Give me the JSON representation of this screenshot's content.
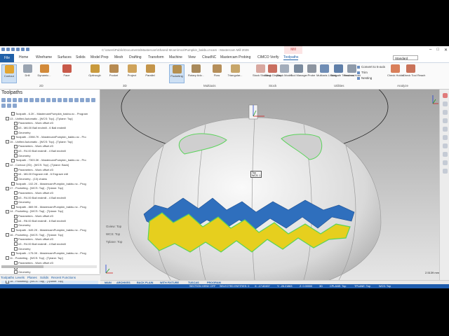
{
  "window": {
    "title": "C:\\Users\\Public\\Documents\\Mastercam\\Shared Mcam\\mcx\\Pumpkin_bakbu.mcam - Mastercam Mill 2026",
    "context_tab": "Mill"
  },
  "tabs": [
    "File",
    "Home",
    "Wireframe",
    "Surfaces",
    "Solids",
    "Model Prep",
    "Mesh",
    "Drafting",
    "Transform",
    "Machine",
    "View",
    "CloudNC",
    "Mastercam Probing",
    "CIMCO Verify",
    "Toolpaths"
  ],
  "tab_active": "Toolpaths",
  "selection_mode": "Standard",
  "ribbon": {
    "buttons": [
      "Contour",
      "Drill",
      "Dynamic...",
      "Face",
      "Optirough",
      "Pocket",
      "Project",
      "Parallel",
      "Pocketing",
      "Rotary Adv...",
      "Flow",
      "Triangular...",
      "Stock Shading",
      "Stock Display",
      "Stock Model",
      "Tool Manager",
      "Probe",
      "Multiaxis Linking",
      "Toolpath Transform",
      "Process Host",
      "Check Holder",
      "Check Tool Reach"
    ],
    "small": [
      "Convert to 5-axis",
      "Trim",
      "Nesting"
    ],
    "groups": [
      "2D",
      "3D",
      "Multiaxis",
      "Stock",
      "Utilities",
      "Analyze"
    ]
  },
  "panel": {
    "title": "Toolpaths",
    "rows": [
      "Toolpath - 6.2K - MastercamPumpkin_bakbu.nc - Program",
      "13 - Unified Automatic - [WCS: Top] - [Tplane: Top]",
      "Parameters - Work offset #3",
      "#3 - M6.00 Ball endmill - 6 Ball endmill",
      "Geometry",
      "Toolpath - 2398.7K - MastercamPumpkin_bakbu.nc - Pro",
      "15 - Unified Automatic - [WCS: Top] - [Tplane: Top]",
      "Parameters - Work offset #3",
      "#3 - R4.00 Ball endmill - 4 Ball endmill",
      "Geometry",
      "Toolpath - 7303.3K - MastercamPumpkin_bakbu.nc - Pro",
      "12 - Contour (2D) - [WCS: Top] - [Tplane: Back]",
      "Parameters - Work offset #3",
      "#4 - M6.00 Engrave mill - 6 Engrave mill",
      "Geometry - (13) chains",
      "Toolpath - 102.2K - MastercamPumpkin_bakbu.nc - Prog",
      "17 - Pocketing - [WCS: Top] - [Tplane: Top]",
      "Parameters - Work offset #3",
      "#3 - R4.00 Ball endmill - 4 Ball endmill",
      "Geometry",
      "Toolpath - 869.9K - MastercamPumpkin_bakbu.nc - Prog",
      "14 - Pocketing - [WCS: Top] - [Tplane: Top]",
      "Parameters - Work offset #3",
      "#4 - R6.00 Ball endmill - 6 Ball endmill",
      "Geometry",
      "Toolpath - 649.2K - MastercamPumpkin_bakbu.nc - Prog",
      "16 - Pocketing - [WCS: Top] - [Tplane: Top]",
      "Parameters - Work offset #3",
      "#3 - R4.00 Ball endmill - 4 Ball endmill",
      "Geometry",
      "Toolpath - 175.0K - MastercamPumpkin_bakbu.nc - Prog",
      "11 - Pocketing - [WCS: Top] - [Tplane: Top]",
      "Parameters - Work offset #3",
      "#3 - R4.00 Ball endmill - 4 Ball endmill",
      "Geometry",
      "Toolpath - 175.0K - MastercamPumpkin_bakbu.nc - Prog",
      "18 - Pocketing - [WCS: Top] - [Tplane: Top]",
      "#5 - R2.00 Ball endmill - 2 Ball endmill",
      "Geometry",
      "Toolpath - 649.2K - MastercamPumpkin_bakbu.nc - Prog"
    ],
    "highlight_index": 36,
    "bottom_tabs": [
      "Toolpaths",
      "Levels",
      "Planes",
      "Solids",
      "Recent Functions"
    ]
  },
  "viewport": {
    "left_labels": [
      "Gview: Top",
      "WCS: Top",
      "Tplane: Top"
    ],
    "tag": [
      "Top",
      "WCS: 1"
    ],
    "scale": "2.5139 mm",
    "view_tabs": [
      "MAIN",
      "ARCHIVES",
      "BACK PLAIN",
      "WITH FIXTURE",
      "TUSCAS",
      "PROGRAM"
    ]
  },
  "status": {
    "items": [
      "SECTION VIEW: OFF",
      "SELECTED ENTITIES: 0",
      "X: -17.82457",
      "Y: -28.21863",
      "Z: 0.00000",
      "3D",
      "CPLANE: Top",
      "TPLANE: Top",
      "WCS: Top"
    ]
  }
}
